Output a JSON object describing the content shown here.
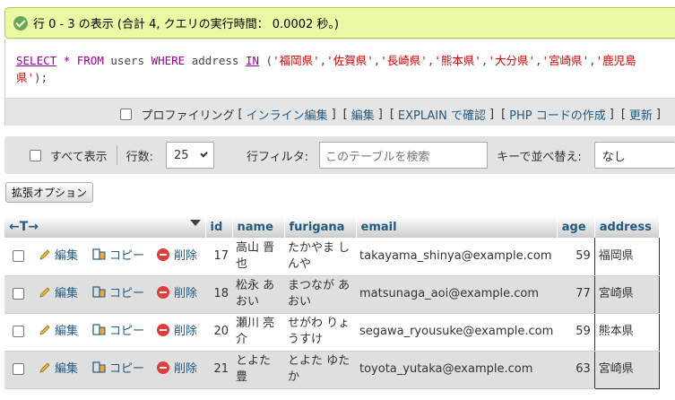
{
  "status": {
    "message": "行 0 - 3 の表示 (合計 4, クエリの実行時間： 0.0002 秒。)"
  },
  "sql": {
    "select": "SELECT",
    "star": "*",
    "from": "FROM",
    "table": "users",
    "where": "WHERE",
    "column": "address",
    "in": "IN",
    "open": "(",
    "values": [
      "'福岡県'",
      "'佐賀県'",
      "'長崎県'",
      "'熊本県'",
      "'大分県'",
      "'宮崎県'",
      "'鹿児島県'"
    ],
    "close": ");"
  },
  "sql_tools": {
    "profiling": "プロファイリング",
    "inline_edit": "インライン編集",
    "edit": "編集",
    "explain": "EXPLAIN で確認",
    "php_code": "PHP コードの作成",
    "refresh": "更新",
    "open_bracket": "[",
    "close_bracket": "]"
  },
  "nav": {
    "show_all": "すべて表示",
    "rows_label": "行数:",
    "rows_value": "25",
    "filter_label": "行フィルタ:",
    "filter_placeholder": "このテーブルを検索",
    "sort_label": "キーで並べ替え:",
    "sort_value": "なし"
  },
  "extra_options": "拡張オプション",
  "table": {
    "arrows": "←T→",
    "headers": [
      "id",
      "name",
      "furigana",
      "email",
      "age",
      "address"
    ],
    "actions": {
      "edit": "編集",
      "copy": "コピー",
      "delete": "削除"
    },
    "rows": [
      {
        "id": "17",
        "name": "高山 晋也",
        "furigana": "たかやま しんや",
        "email": "takayama_shinya@example.com",
        "age": "59",
        "address": "福岡県"
      },
      {
        "id": "18",
        "name": "松永 あおい",
        "furigana": "まつなが あおい",
        "email": "matsunaga_aoi@example.com",
        "age": "77",
        "address": "宮崎県"
      },
      {
        "id": "20",
        "name": "瀬川 亮介",
        "furigana": "せがわ りょうすけ",
        "email": "segawa_ryousuke@example.com",
        "age": "59",
        "address": "熊本県"
      },
      {
        "id": "21",
        "name": "とよた 豊",
        "furigana": "とよた ゆたか",
        "email": "toyota_yutaka@example.com",
        "age": "63",
        "address": "宮崎県"
      }
    ]
  },
  "colors": {
    "link": "#235a81",
    "success_bg": "#ebf8a4",
    "keyword": "#990099",
    "string": "#cc0000"
  }
}
